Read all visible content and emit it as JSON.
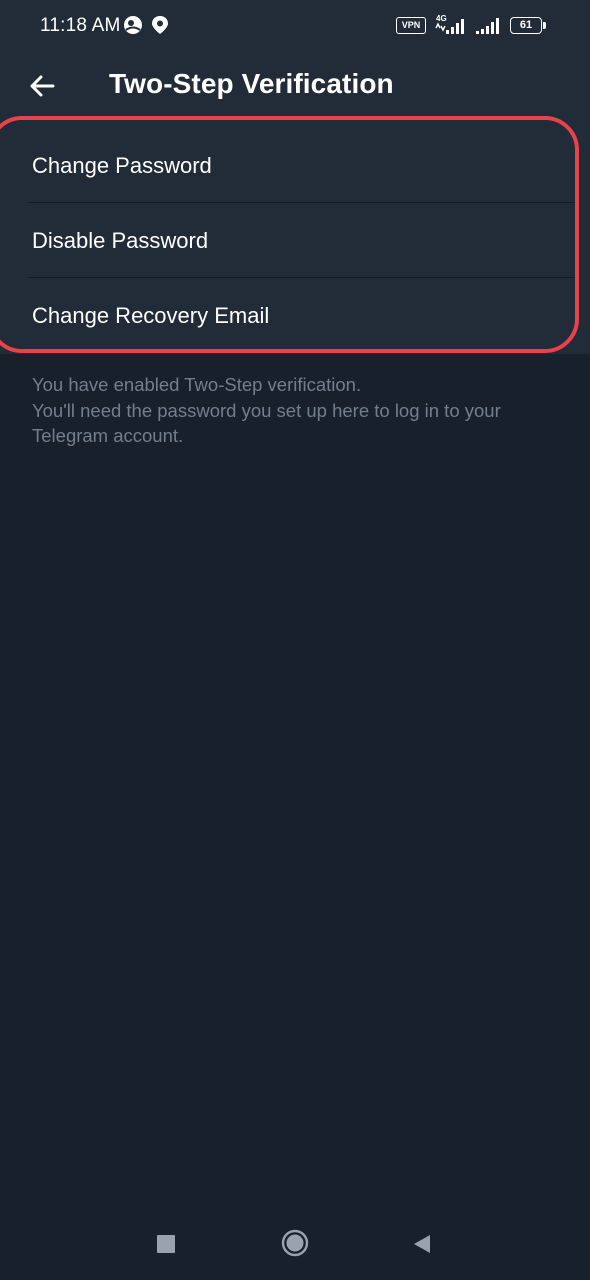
{
  "status_bar": {
    "time": "11:18 AM",
    "vpn_label": "VPN",
    "network_label": "4G",
    "battery_level": "61",
    "icons": [
      "profile-icon",
      "location-icon",
      "signal-icon",
      "wifi-signal-icon"
    ]
  },
  "header": {
    "title": "Two-Step Verification",
    "back_icon": "arrow-left-icon"
  },
  "menu": {
    "items": [
      {
        "label": "Change Password"
      },
      {
        "label": "Disable Password"
      },
      {
        "label": "Change Recovery Email"
      }
    ]
  },
  "info": {
    "line1": "You have enabled Two-Step verification.",
    "line2": "You'll need the password you set up here to log in to your",
    "line3": "Telegram account."
  },
  "nav": {
    "icons": [
      "recents-square-icon",
      "home-circle-icon",
      "back-triangle-icon"
    ]
  },
  "colors": {
    "background": "#18202b",
    "surface": "#222b38",
    "highlight": "#e8424a",
    "secondary_text": "#747f8c"
  }
}
